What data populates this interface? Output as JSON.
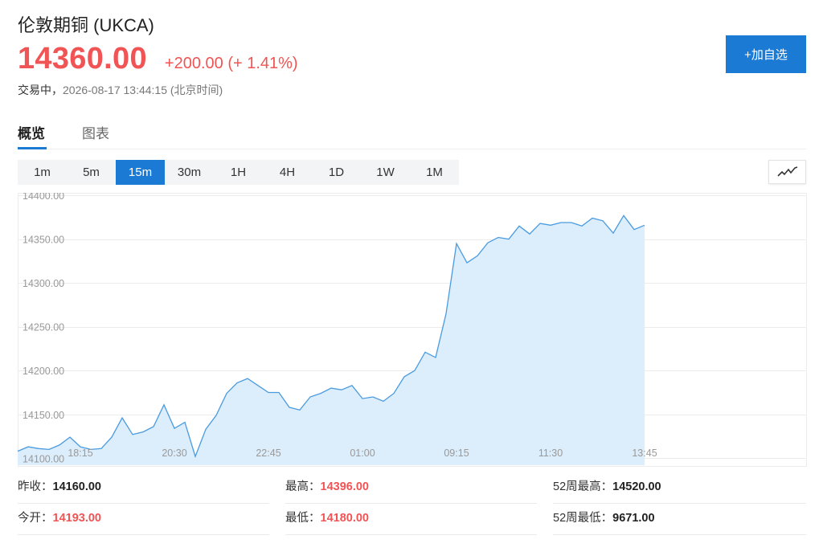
{
  "header": {
    "title": "伦敦期铜 (UKCA)",
    "price": "14360.00",
    "change": "+200.00 (+ 1.41%)",
    "status_label": "交易中，",
    "status_time": "2026-08-17 13:44:15 (北京时间)",
    "add_button": "+加自选"
  },
  "tabs": [
    {
      "label": "概览",
      "active": true
    },
    {
      "label": "图表",
      "active": false
    }
  ],
  "intervals": [
    {
      "label": "1m",
      "active": false
    },
    {
      "label": "5m",
      "active": false
    },
    {
      "label": "15m",
      "active": true
    },
    {
      "label": "30m",
      "active": false
    },
    {
      "label": "1H",
      "active": false
    },
    {
      "label": "4H",
      "active": false
    },
    {
      "label": "1D",
      "active": false
    },
    {
      "label": "1W",
      "active": false
    },
    {
      "label": "1M",
      "active": false
    }
  ],
  "colors": {
    "up": "#f05454",
    "accent": "#1a7ad4",
    "line": "#4a9be0",
    "area": "#dcedfb"
  },
  "chart_data": {
    "type": "area",
    "y_ticks": [
      "14100.00",
      "14150.00",
      "14200.00",
      "14250.00",
      "14300.00",
      "14350.00",
      "14400.00"
    ],
    "ylim": [
      14092,
      14402
    ],
    "x_ticks": [
      {
        "label": "18:15",
        "index": 6
      },
      {
        "label": "20:30",
        "index": 15
      },
      {
        "label": "22:45",
        "index": 24
      },
      {
        "label": "01:00",
        "index": 33
      },
      {
        "label": "09:15",
        "index": 42
      },
      {
        "label": "11:30",
        "index": 51
      },
      {
        "label": "13:45",
        "index": 60
      }
    ],
    "x_count": 68,
    "values": [
      14108,
      14113,
      14111,
      14110,
      14115,
      14124,
      14113,
      14110,
      14111,
      14124,
      14146,
      14127,
      14130,
      14136,
      14161,
      14134,
      14141,
      14102,
      14133,
      14149,
      14174,
      14186,
      14191,
      14183,
      14175,
      14175,
      14158,
      14155,
      14170,
      14174,
      14180,
      14178,
      14183,
      14168,
      14170,
      14165,
      14174,
      14193,
      14200,
      14221,
      14215,
      14265,
      14345,
      14323,
      14331,
      14346,
      14352,
      14350,
      14365,
      14356,
      14368,
      14366,
      14369,
      14369,
      14365,
      14374,
      14371,
      14357,
      14377,
      14361,
      14366
    ],
    "grid": true,
    "legend": "none"
  },
  "stats": [
    [
      {
        "label": "昨收：",
        "value": "14160.00",
        "red": false
      },
      {
        "label": "最高：",
        "value": "14396.00",
        "red": true
      },
      {
        "label": "52周最高：",
        "value": "14520.00",
        "red": false
      }
    ],
    [
      {
        "label": "今开：",
        "value": "14193.00",
        "red": true
      },
      {
        "label": "最低：",
        "value": "14180.00",
        "red": true
      },
      {
        "label": "52周最低：",
        "value": "9671.00",
        "red": false
      }
    ]
  ]
}
